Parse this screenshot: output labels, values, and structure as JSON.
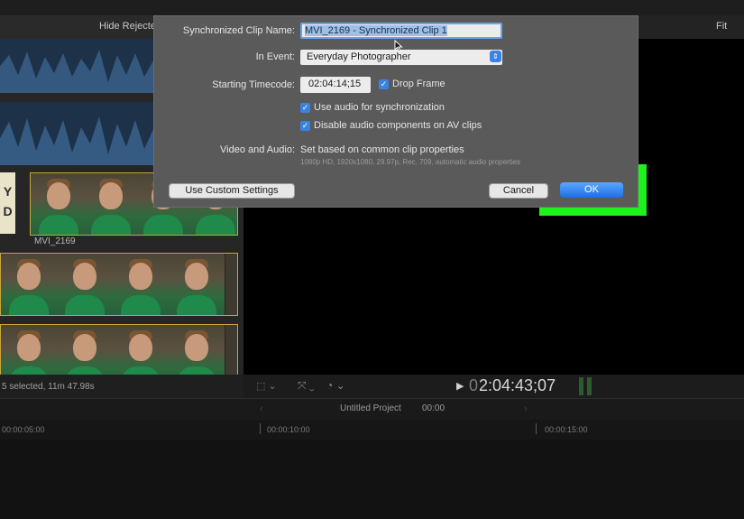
{
  "browser": {
    "hide_rejected_label": "Hide Rejecte",
    "clip_left_label": "Y\nD",
    "clip_name": "MVI_2169",
    "status": "5 selected, 11m 47.98s"
  },
  "viewer": {
    "fit_label": "Fit",
    "timecode": "2:04:43;07",
    "timecode_prefix": "0"
  },
  "timeline": {
    "project_name": "Untitled Project",
    "project_duration": "00:00",
    "ruler": [
      "00:00:05:00",
      "00:00:10:00",
      "00:00:15:00"
    ]
  },
  "dialog": {
    "clip_name_label": "Synchronized Clip Name:",
    "clip_name_value": "MVI_2169 - Synchronized Clip 1",
    "event_label": "In Event:",
    "event_value": "Everyday Photographer",
    "timecode_label": "Starting Timecode:",
    "timecode_value": "02:04:14;15",
    "drop_frame_label": "Drop Frame",
    "use_audio_label": "Use audio for synchronization",
    "disable_audio_label": "Disable audio components on AV clips",
    "video_audio_label": "Video and Audio:",
    "video_audio_value": "Set based on common clip properties",
    "video_audio_detail": "1080p HD, 1920x1080, 29.97p, Rec. 709, automatic audio properties",
    "custom_settings_button": "Use Custom Settings",
    "cancel_button": "Cancel",
    "ok_button": "OK"
  },
  "colors": {
    "highlight": "#1df21d",
    "ok_blue": "#2f80ec",
    "clip_border": "#c9a53a"
  }
}
